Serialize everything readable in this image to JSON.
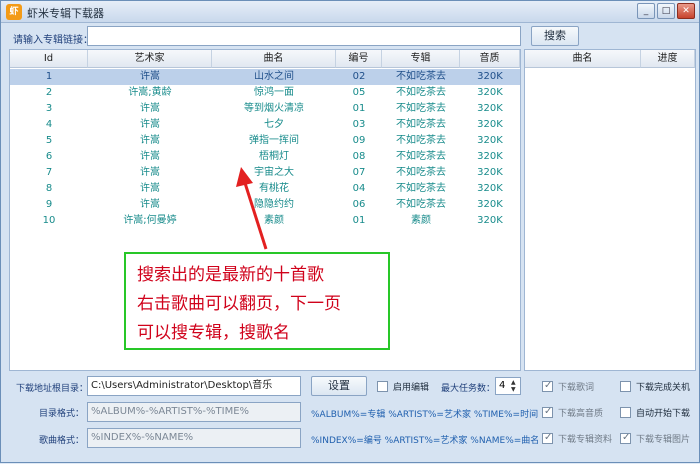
{
  "window": {
    "title": "虾米专辑下载器",
    "icon_text": "虾"
  },
  "search": {
    "label": "请输入专辑链接：",
    "value": "",
    "button": "搜索"
  },
  "table": {
    "headers": {
      "id": "Id",
      "artist": "艺术家",
      "song": "曲名",
      "no": "编号",
      "album": "专辑",
      "quality": "音质"
    },
    "rows": [
      {
        "id": "1",
        "artist": "许嵩",
        "song": "山水之间",
        "no": "02",
        "album": "不如吃茶去",
        "quality": "320K"
      },
      {
        "id": "2",
        "artist": "许嵩;黄龄",
        "song": "惊鸿一面",
        "no": "05",
        "album": "不如吃茶去",
        "quality": "320K"
      },
      {
        "id": "3",
        "artist": "许嵩",
        "song": "等到烟火清凉",
        "no": "01",
        "album": "不如吃茶去",
        "quality": "320K"
      },
      {
        "id": "4",
        "artist": "许嵩",
        "song": "七夕",
        "no": "03",
        "album": "不如吃茶去",
        "quality": "320K"
      },
      {
        "id": "5",
        "artist": "许嵩",
        "song": "弹指一挥间",
        "no": "09",
        "album": "不如吃茶去",
        "quality": "320K"
      },
      {
        "id": "6",
        "artist": "许嵩",
        "song": "梧桐灯",
        "no": "08",
        "album": "不如吃茶去",
        "quality": "320K"
      },
      {
        "id": "7",
        "artist": "许嵩",
        "song": "宇宙之大",
        "no": "07",
        "album": "不如吃茶去",
        "quality": "320K"
      },
      {
        "id": "8",
        "artist": "许嵩",
        "song": "有桃花",
        "no": "04",
        "album": "不如吃茶去",
        "quality": "320K"
      },
      {
        "id": "9",
        "artist": "许嵩",
        "song": "隐隐约约",
        "no": "06",
        "album": "不如吃茶去",
        "quality": "320K"
      },
      {
        "id": "10",
        "artist": "许嵩;何曼婷",
        "song": "素颜",
        "no": "01",
        "album": "素颜",
        "quality": "320K"
      }
    ]
  },
  "side": {
    "headers": {
      "song": "曲名",
      "progress": "进度"
    }
  },
  "annotation": {
    "lines": [
      "搜索出的是最新的十首歌",
      "右击歌曲可以翻页，下一页",
      "可以搜专辑，搜歌名"
    ]
  },
  "settings": {
    "download_dir_label": "下载地址根目录：",
    "download_dir_value": "C:\\Users\\Administrator\\Desktop\\音乐",
    "set_button": "设置",
    "enable_edit": "启用编辑",
    "max_tasks_label": "最大任务数：",
    "max_tasks_value": "4",
    "dir_format_label": "目录格式：",
    "dir_format_value": "%ALBUM%-%ARTIST%-%TIME%",
    "dir_format_hint": "%ALBUM%=专辑 %ARTIST%=艺术家 %TIME%=时间",
    "song_format_label": "歌曲格式：",
    "song_format_value": "%INDEX%-%NAME%",
    "song_format_hint": "%INDEX%=编号 %ARTIST%=艺术家 %NAME%=曲名",
    "options": {
      "download_lyrics": "下载歌词",
      "shutdown": "下载完成关机",
      "hq": "下载高音质",
      "auto_start": "自动开始下载",
      "album_info": "下载专辑资料",
      "album_cover": "下载专辑图片"
    }
  },
  "colors": {
    "accent": "#178b8b",
    "callout_border": "#28c728",
    "callout_text": "#d0021b"
  }
}
